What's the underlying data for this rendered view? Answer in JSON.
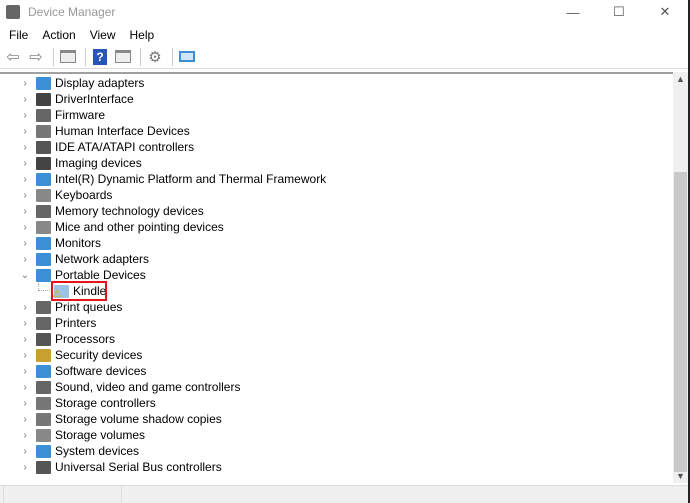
{
  "window": {
    "title": "Device Manager",
    "minimize": "—",
    "maximize": "☐",
    "close": "✕"
  },
  "menu": [
    "File",
    "Action",
    "View",
    "Help"
  ],
  "toolbar": [
    "back",
    "forward",
    "properties",
    "help",
    "update-driver",
    "scan-hardware",
    "computer"
  ],
  "tree": [
    {
      "label": "Display adapters",
      "color": "#3a8fd6"
    },
    {
      "label": "DriverInterface",
      "color": "#444"
    },
    {
      "label": "Firmware",
      "color": "#666"
    },
    {
      "label": "Human Interface Devices",
      "color": "#777"
    },
    {
      "label": "IDE ATA/ATAPI controllers",
      "color": "#555"
    },
    {
      "label": "Imaging devices",
      "color": "#444"
    },
    {
      "label": "Intel(R) Dynamic Platform and Thermal Framework",
      "color": "#3a8fd6"
    },
    {
      "label": "Keyboards",
      "color": "#888"
    },
    {
      "label": "Memory technology devices",
      "color": "#666"
    },
    {
      "label": "Mice and other pointing devices",
      "color": "#888"
    },
    {
      "label": "Monitors",
      "color": "#3a8fd6"
    },
    {
      "label": "Network adapters",
      "color": "#3a8fd6"
    },
    {
      "label": "Portable Devices",
      "color": "#3a8fd6",
      "expanded": true
    },
    {
      "label": "Kindle",
      "color": "#9cc3e6",
      "child": true,
      "warning": true
    },
    {
      "label": "Print queues",
      "color": "#666"
    },
    {
      "label": "Printers",
      "color": "#666"
    },
    {
      "label": "Processors",
      "color": "#555"
    },
    {
      "label": "Security devices",
      "color": "#c8a030"
    },
    {
      "label": "Software devices",
      "color": "#3a8fd6"
    },
    {
      "label": "Sound, video and game controllers",
      "color": "#666"
    },
    {
      "label": "Storage controllers",
      "color": "#777"
    },
    {
      "label": "Storage volume shadow copies",
      "color": "#777"
    },
    {
      "label": "Storage volumes",
      "color": "#888"
    },
    {
      "label": "System devices",
      "color": "#3a8fd6"
    },
    {
      "label": "Universal Serial Bus controllers",
      "color": "#555"
    }
  ],
  "highlight_color": "#e3141b"
}
